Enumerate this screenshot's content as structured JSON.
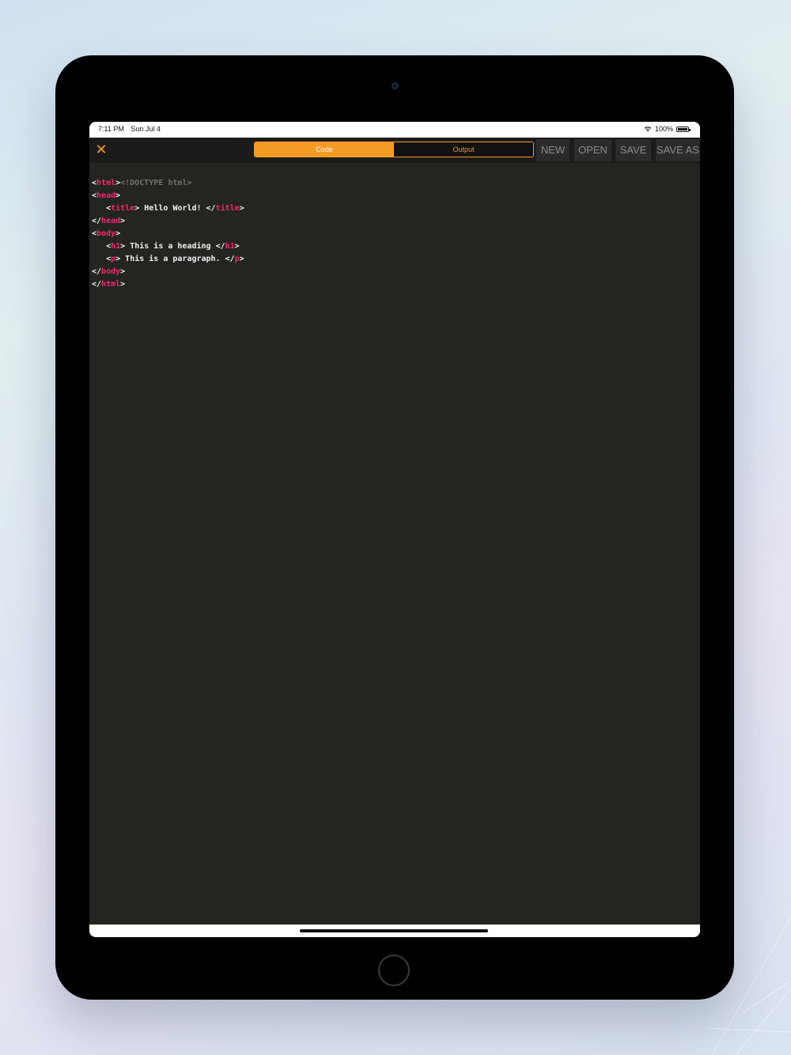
{
  "status_bar": {
    "time": "7:11 PM",
    "date": "Sun Jul 4",
    "battery_text": "100%",
    "wifi_icon": "wifi-icon",
    "battery_icon": "battery-icon"
  },
  "toolbar": {
    "close_icon": "close-icon",
    "tabs": [
      {
        "label": "Code",
        "active": true
      },
      {
        "label": "Output",
        "active": false
      }
    ],
    "new_label": "NEW",
    "open_label": "OPEN",
    "save_label": "SAVE",
    "save_as_label": "SAVE AS"
  },
  "editor": {
    "lines": [
      {
        "doctype": "<!DOCTYPE html>"
      },
      {
        "indent": "",
        "open": "<",
        "tag": "html",
        "close": ">",
        "text": "",
        "open2": "",
        "tag2": "",
        "close2": ""
      },
      {
        "indent": "",
        "open": "<",
        "tag": "head",
        "close": ">",
        "text": "",
        "open2": "",
        "tag2": "",
        "close2": ""
      },
      {
        "indent": "   ",
        "open": "<",
        "tag": "title",
        "close": ">",
        "text": " Hello World! ",
        "open2": "</",
        "tag2": "title",
        "close2": ">"
      },
      {
        "indent": "",
        "open": "</",
        "tag": "head",
        "close": ">",
        "text": "",
        "open2": "",
        "tag2": "",
        "close2": ""
      },
      {
        "indent": "",
        "open": "<",
        "tag": "body",
        "close": ">",
        "text": "",
        "open2": "",
        "tag2": "",
        "close2": ""
      },
      {
        "indent": "   ",
        "open": "<",
        "tag": "h1",
        "close": ">",
        "text": " This is a heading ",
        "open2": "</",
        "tag2": "h1",
        "close2": ">"
      },
      {
        "indent": "   ",
        "open": "<",
        "tag": "p",
        "close": ">",
        "text": " This is a paragraph. ",
        "open2": "</",
        "tag2": "p",
        "close2": ">"
      },
      {
        "indent": "",
        "open": "</",
        "tag": "body",
        "close": ">",
        "text": "",
        "open2": "",
        "tag2": "",
        "close2": ""
      },
      {
        "indent": "",
        "open": "</",
        "tag": "html",
        "close": ">",
        "text": "",
        "open2": "",
        "tag2": "",
        "close2": ""
      }
    ]
  },
  "colors": {
    "accent": "#f59a23",
    "editor_bg": "#232520",
    "tag": "#f92672",
    "doctype": "#72726a",
    "text": "#f1f1f1"
  }
}
